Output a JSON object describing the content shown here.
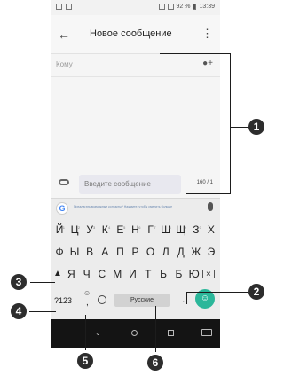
{
  "status_bar": {
    "battery": "92 %",
    "time": "13:39"
  },
  "app_bar": {
    "title": "Новое сообщение",
    "back_glyph": "←",
    "menu_glyph": "⋮"
  },
  "recipient": {
    "placeholder": "Кому"
  },
  "compose": {
    "placeholder": "Введите сообщение",
    "counter": "160 / 1"
  },
  "keyboard": {
    "suggestion_text": "Предлагать возможные контакты? Нажмите, чтобы сменить больше",
    "row1": [
      {
        "key": "Й",
        "hint": "1"
      },
      {
        "key": "Ц",
        "hint": "2"
      },
      {
        "key": "У",
        "hint": "3"
      },
      {
        "key": "К",
        "hint": "4"
      },
      {
        "key": "Е",
        "hint": "5"
      },
      {
        "key": "Н",
        "hint": "6"
      },
      {
        "key": "Г",
        "hint": "7"
      },
      {
        "key": "Ш",
        "hint": "8"
      },
      {
        "key": "Щ",
        "hint": "9"
      },
      {
        "key": "З",
        "hint": "0"
      },
      {
        "key": "Х",
        "hint": ""
      }
    ],
    "row2": [
      "Ф",
      "Ы",
      "В",
      "А",
      "П",
      "Р",
      "О",
      "Л",
      "Д",
      "Ж",
      "Э"
    ],
    "row3": [
      "Я",
      "Ч",
      "С",
      "М",
      "И",
      "Т",
      "Ь",
      "Б",
      "Ю"
    ],
    "numbers_label": "?123",
    "comma_label": ",",
    "period_label": ".",
    "space_label": "Русские"
  },
  "callouts": [
    "1",
    "2",
    "3",
    "4",
    "5",
    "6"
  ],
  "icons": {
    "add_contact": "add-person-icon",
    "attach": "attach-icon",
    "mic": "mic-icon",
    "shift": "shift-icon",
    "backspace": "backspace-icon",
    "emoji": "emoji-icon",
    "globe": "globe-icon",
    "enter": "emoji-smile-icon"
  },
  "colors": {
    "enter_key": "#2bb79a",
    "nav_bar": "#141414",
    "callout": "#2d2d2d"
  }
}
